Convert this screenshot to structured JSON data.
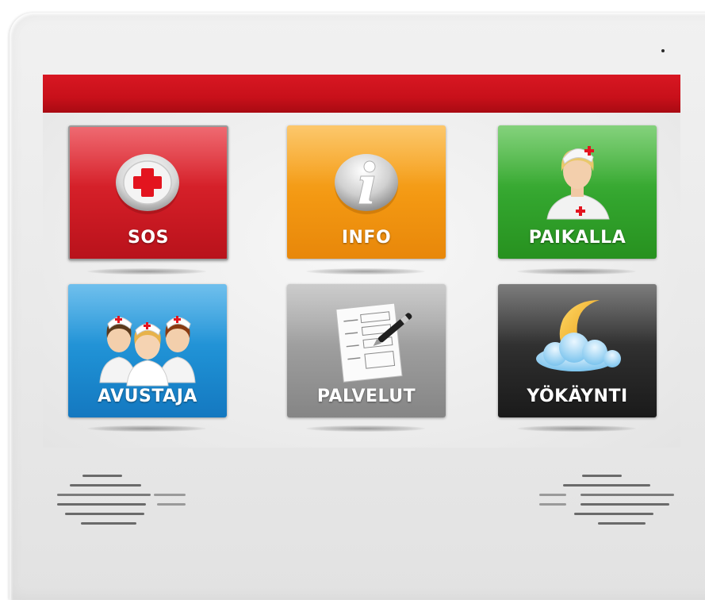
{
  "screen": {
    "tiles": [
      {
        "id": "sos",
        "label": "SOS",
        "icon": "red-cross-icon",
        "color": "#d11d26"
      },
      {
        "id": "info",
        "label": "INFO",
        "icon": "info-icon",
        "color": "#f39812"
      },
      {
        "id": "paikalla",
        "label": "PAIKALLA",
        "icon": "nurse-icon",
        "color": "#33a52e"
      },
      {
        "id": "avustaja",
        "label": "AVUSTAJA",
        "icon": "nurses-group-icon",
        "color": "#1e8fd3"
      },
      {
        "id": "palvelut",
        "label": "PALVELUT",
        "icon": "document-pen-icon",
        "color": "#9a9a9a"
      },
      {
        "id": "yokaynti",
        "label": "YÖKÄYNTI",
        "icon": "moon-cloud-icon",
        "color": "#2c2c2c"
      }
    ],
    "title_bar_color": "#c8101a"
  }
}
